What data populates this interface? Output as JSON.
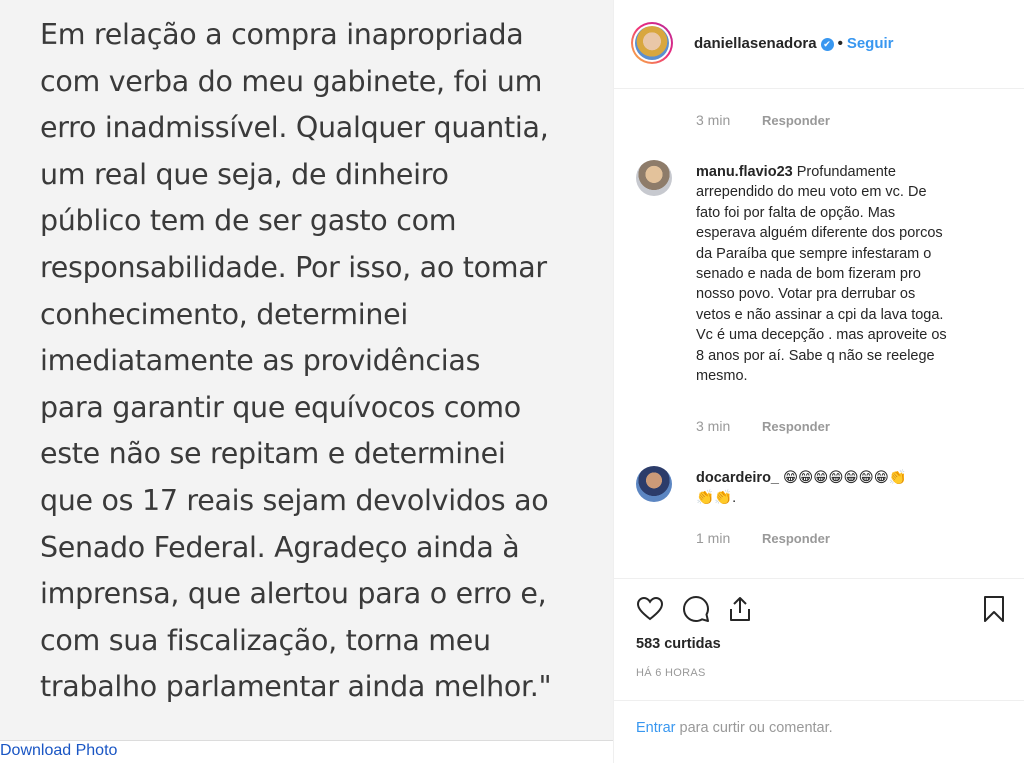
{
  "photo": {
    "lines": [
      "Em relação a compra inapropriada",
      "com verba do meu gabinete, foi um",
      "erro inadmissível. Qualquer quantia,",
      "um real que seja, de dinheiro",
      "público tem de ser gasto com",
      "responsabilidade. Por isso, ao tomar",
      "conhecimento, determinei",
      "imediatamente as providências",
      "para garantir que equívocos como",
      "este não se repitam e determinei",
      "que os 17 reais sejam devolvidos ao",
      "Senado Federal. Agradeço ainda à",
      "imprensa, que alertou para o erro e,",
      "com sua fiscalização, torna meu",
      "trabalho parlamentar ainda melhor.\""
    ],
    "download_label": "Download Photo"
  },
  "header": {
    "username": "daniellasenadora",
    "verified_mark": "✔",
    "separator": "•",
    "follow_label": "Seguir"
  },
  "comments": {
    "top_meta": {
      "time": "3 min",
      "reply": "Responder"
    },
    "items": [
      {
        "username": "manu.flavio23",
        "lines": [
          "Profundamente",
          "arrependido do meu voto em vc. De",
          "fato foi por falta de opção. Mas",
          "esperava alguém diferente dos porcos",
          "da Paraíba que sempre infestaram o",
          "senado e nada de bom fizeram pro",
          "nosso povo. Votar pra derrubar os",
          "vetos e não assinar a cpi da lava toga.",
          "Vc é uma decepção . mas aproveite os",
          "8 anos por aí. Sabe q não se reelege",
          "mesmo."
        ],
        "time": "3 min",
        "reply": "Responder"
      },
      {
        "username": "docardeiro_",
        "emoji_text": "😁😁😁😁😁😁😁👏",
        "second_line": "👏👏.",
        "time": "1 min",
        "reply": "Responder"
      }
    ]
  },
  "actions": {
    "icons": [
      "heart-icon",
      "comment-icon",
      "share-icon",
      "bookmark-icon"
    ],
    "likes": "583 curtidas",
    "ago": "HÁ 6 HORAS"
  },
  "login": {
    "link": "Entrar",
    "text": "para curtir ou comentar."
  },
  "colors": {
    "accent": "#3897f0",
    "muted": "#999999",
    "text": "#262626"
  }
}
